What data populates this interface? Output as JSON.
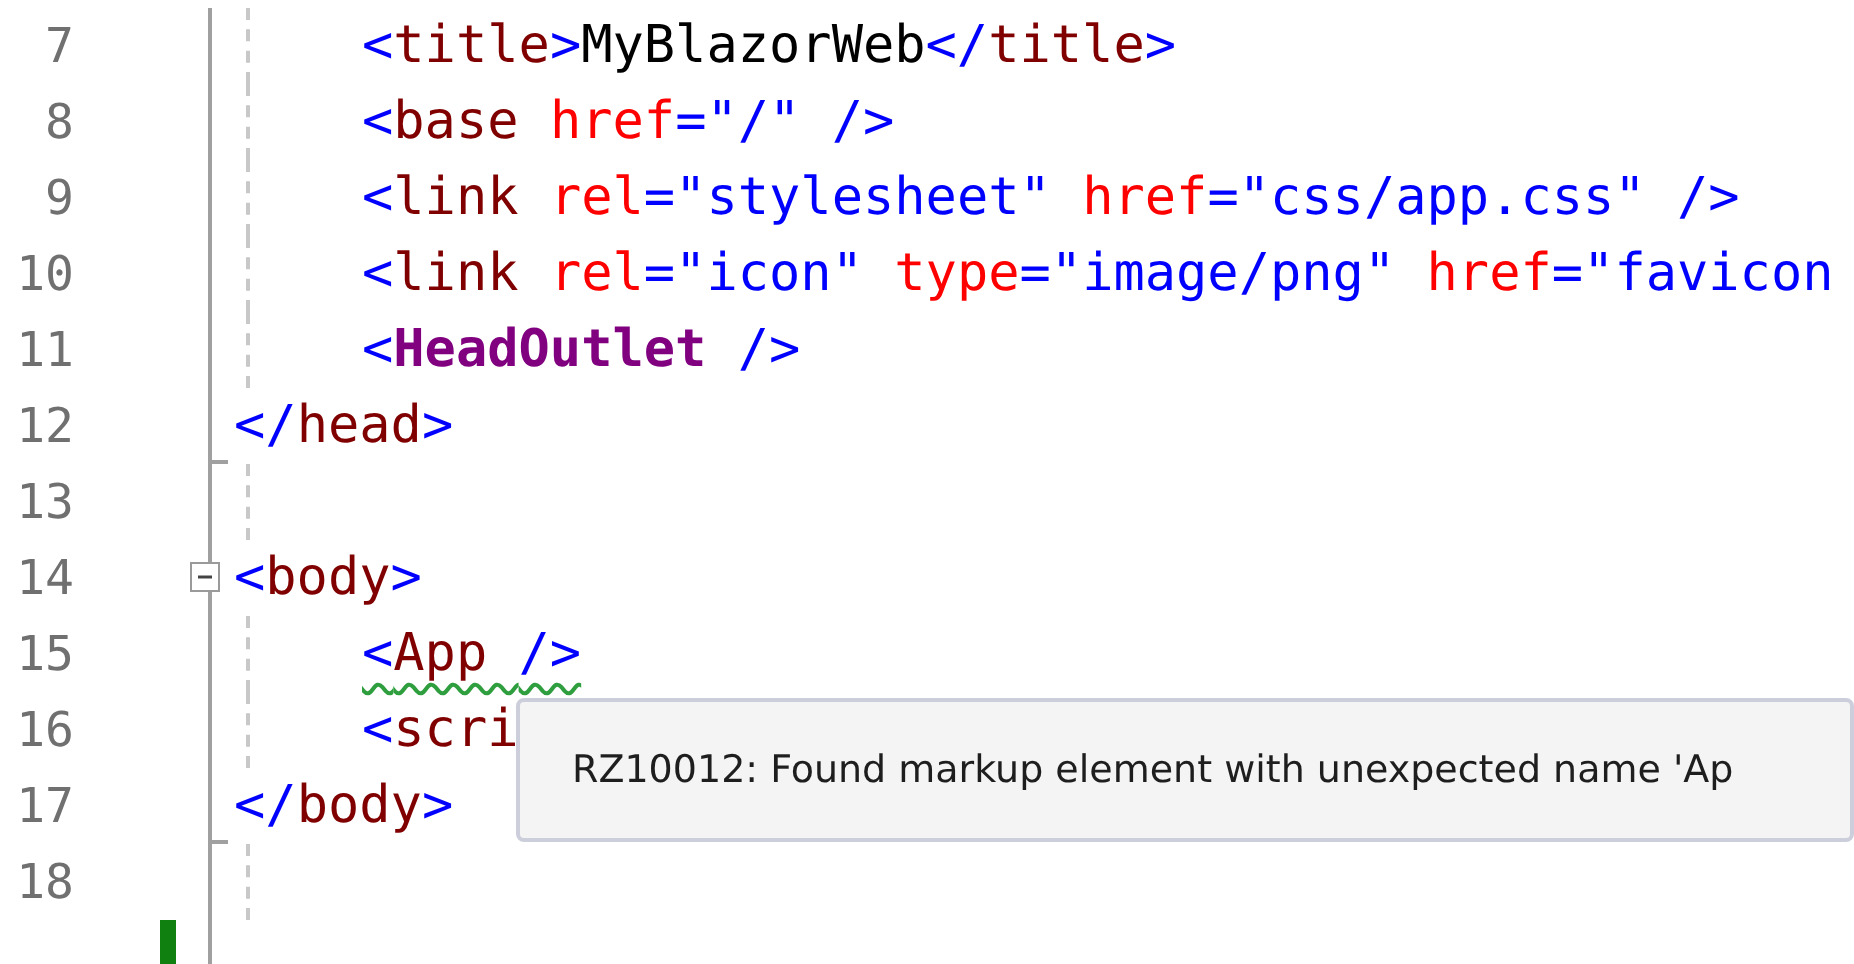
{
  "editor": {
    "lines": [
      {
        "number": "7",
        "indented": true,
        "tokens": [
          {
            "kind": "bracket",
            "text": "<"
          },
          {
            "kind": "tag",
            "text": "title"
          },
          {
            "kind": "bracket",
            "text": ">"
          },
          {
            "kind": "text",
            "text": "MyBlazorWeb"
          },
          {
            "kind": "bracket",
            "text": "</"
          },
          {
            "kind": "tag",
            "text": "title"
          },
          {
            "kind": "bracket",
            "text": ">"
          }
        ]
      },
      {
        "number": "8",
        "indented": true,
        "tokens": [
          {
            "kind": "bracket",
            "text": "<"
          },
          {
            "kind": "tag",
            "text": "base "
          },
          {
            "kind": "attr",
            "text": "href"
          },
          {
            "kind": "value",
            "text": "=\"/\" />"
          }
        ]
      },
      {
        "number": "9",
        "indented": true,
        "tokens": [
          {
            "kind": "bracket",
            "text": "<"
          },
          {
            "kind": "tag",
            "text": "link "
          },
          {
            "kind": "attr",
            "text": "rel"
          },
          {
            "kind": "value",
            "text": "=\"stylesheet\" "
          },
          {
            "kind": "attr",
            "text": "href"
          },
          {
            "kind": "value",
            "text": "=\"css/app.css\" />"
          }
        ]
      },
      {
        "number": "10",
        "indented": true,
        "tokens": [
          {
            "kind": "bracket",
            "text": "<"
          },
          {
            "kind": "tag",
            "text": "link "
          },
          {
            "kind": "attr",
            "text": "rel"
          },
          {
            "kind": "value",
            "text": "=\"icon\" "
          },
          {
            "kind": "attr",
            "text": "type"
          },
          {
            "kind": "value",
            "text": "=\"image/png\" "
          },
          {
            "kind": "attr",
            "text": "href"
          },
          {
            "kind": "value",
            "text": "=\"favicon"
          }
        ]
      },
      {
        "number": "11",
        "indented": true,
        "tokens": [
          {
            "kind": "bracket",
            "text": "<"
          },
          {
            "kind": "component",
            "text": "HeadOutlet"
          },
          {
            "kind": "bracket",
            "text": " />"
          }
        ]
      },
      {
        "number": "12",
        "indented": false,
        "fold_end": true,
        "tokens": [
          {
            "kind": "bracket",
            "text": "</"
          },
          {
            "kind": "tag",
            "text": "head"
          },
          {
            "kind": "bracket",
            "text": ">"
          }
        ]
      },
      {
        "number": "13"
      },
      {
        "number": "14",
        "indented": false,
        "expanded": true,
        "tokens": [
          {
            "kind": "bracket",
            "text": "<"
          },
          {
            "kind": "tag",
            "text": "body"
          },
          {
            "kind": "bracket",
            "text": ">"
          }
        ]
      },
      {
        "number": "15",
        "indented": true,
        "warning": true,
        "tokens": [
          {
            "kind": "bracket",
            "text": "<"
          },
          {
            "kind": "tag",
            "text": "App "
          },
          {
            "kind": "bracket",
            "text": "/>"
          }
        ]
      },
      {
        "number": "16",
        "indented": true,
        "tokens": [
          {
            "kind": "bracket",
            "text": "<"
          },
          {
            "kind": "tag",
            "text": "scri"
          }
        ]
      },
      {
        "number": "17",
        "indented": false,
        "fold_end": true,
        "tokens": [
          {
            "kind": "bracket",
            "text": "</"
          },
          {
            "kind": "tag",
            "text": "body"
          },
          {
            "kind": "bracket",
            "text": ">"
          }
        ]
      },
      {
        "number": "18"
      },
      {
        "changed": true
      }
    ]
  },
  "tooltip": {
    "message": "RZ10012: Found markup element with unexpected name 'Ap"
  }
}
